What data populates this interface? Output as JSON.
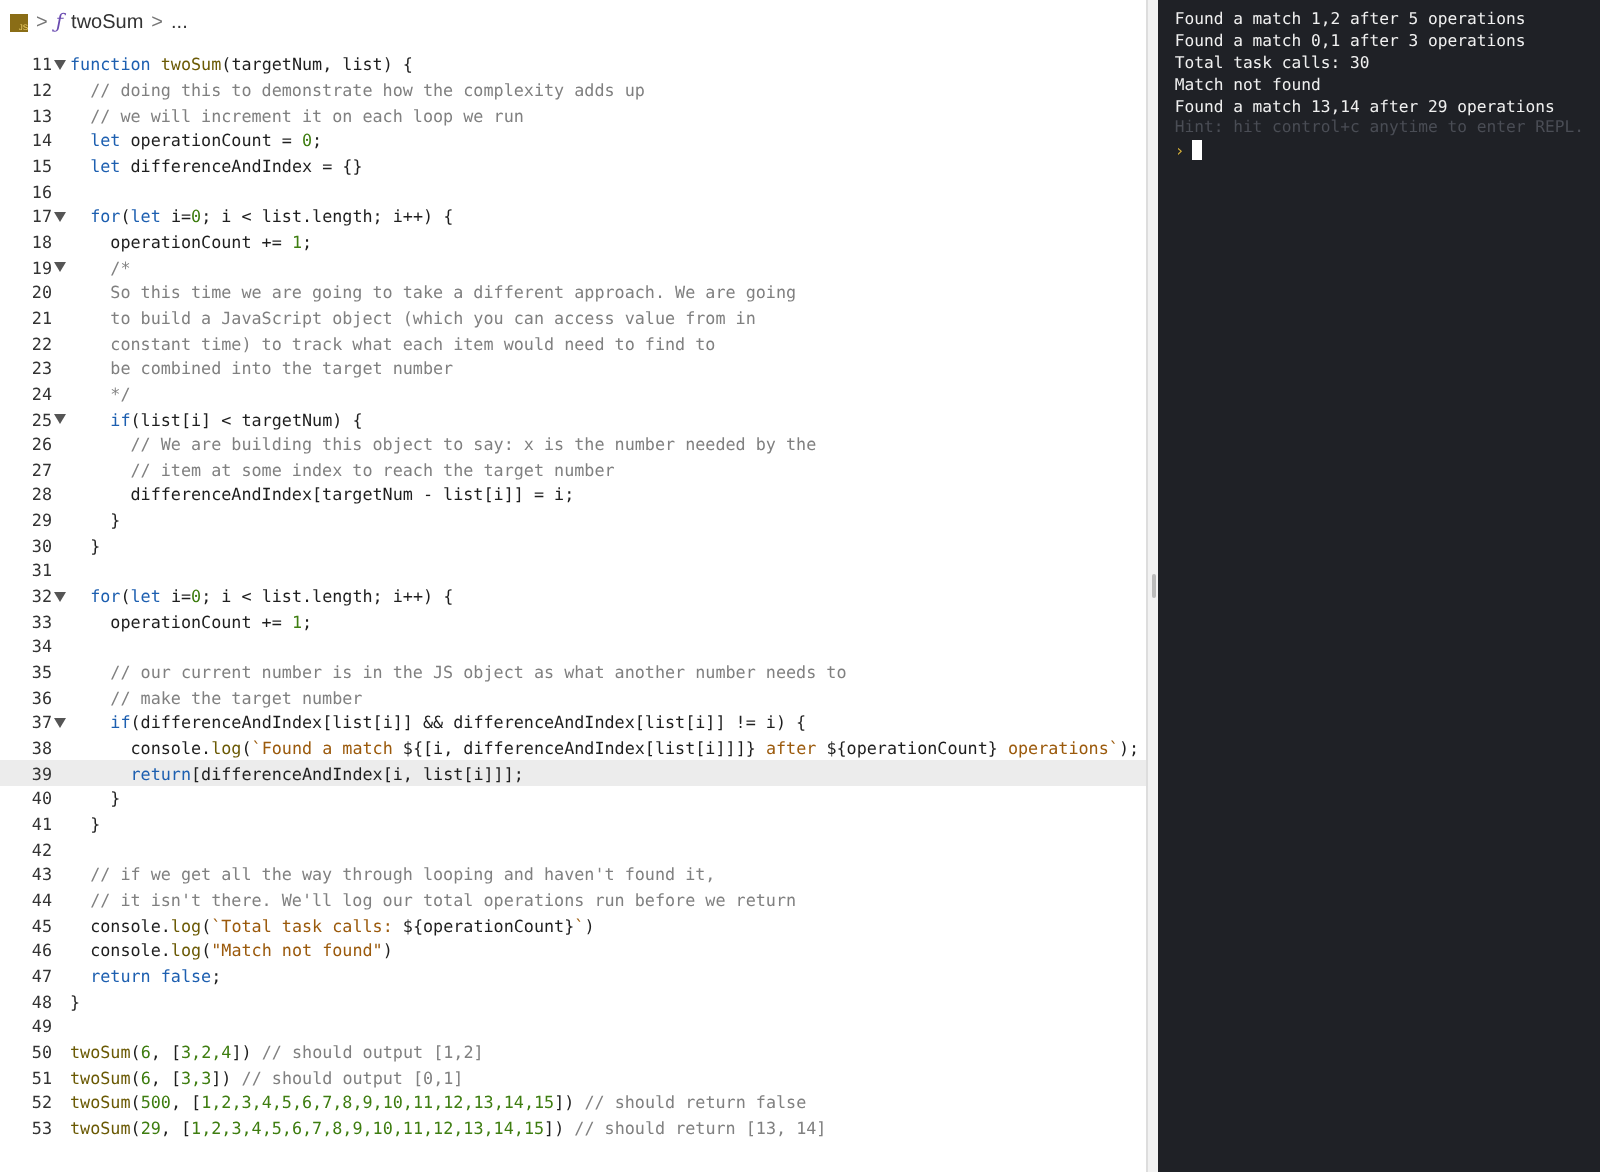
{
  "breadcrumb": {
    "file_icon": "JS",
    "symbol_icon": "ƒ",
    "symbol": "twoSum",
    "separator": ">",
    "rest": "..."
  },
  "editor": {
    "lines": [
      {
        "number": "11",
        "foldable": true,
        "current": false,
        "tokens": [
          {
            "kind": "kw",
            "text": "function "
          },
          {
            "kind": "fn",
            "text": "twoSum"
          },
          {
            "kind": "plain",
            "text": "(targetNum, list) {"
          }
        ]
      },
      {
        "number": "12",
        "foldable": false,
        "current": false,
        "tokens": [
          {
            "kind": "cm",
            "text": "  // doing this to demonstrate how the complexity adds up"
          }
        ]
      },
      {
        "number": "13",
        "foldable": false,
        "current": false,
        "tokens": [
          {
            "kind": "cm",
            "text": "  // we will increment it on each loop we run"
          }
        ]
      },
      {
        "number": "14",
        "foldable": false,
        "current": false,
        "tokens": [
          {
            "kind": "kw",
            "text": "  let "
          },
          {
            "kind": "plain",
            "text": "operationCount = "
          },
          {
            "kind": "num",
            "text": "0"
          },
          {
            "kind": "plain",
            "text": ";"
          }
        ]
      },
      {
        "number": "15",
        "foldable": false,
        "current": false,
        "tokens": [
          {
            "kind": "kw",
            "text": "  let "
          },
          {
            "kind": "plain",
            "text": "differenceAndIndex = {}"
          }
        ]
      },
      {
        "number": "16",
        "foldable": false,
        "current": false
      },
      {
        "number": "17",
        "foldable": true,
        "current": false,
        "tokens": [
          {
            "kind": "kw",
            "text": "  for"
          },
          {
            "kind": "plain",
            "text": "("
          },
          {
            "kind": "kw",
            "text": "let "
          },
          {
            "kind": "plain",
            "text": "i="
          },
          {
            "kind": "num",
            "text": "0"
          },
          {
            "kind": "plain",
            "text": "; i < list.length; i++) {"
          }
        ]
      },
      {
        "number": "18",
        "foldable": false,
        "current": false,
        "tokens": [
          {
            "kind": "plain",
            "text": "    operationCount += "
          },
          {
            "kind": "num",
            "text": "1"
          },
          {
            "kind": "plain",
            "text": ";"
          }
        ]
      },
      {
        "number": "19",
        "foldable": true,
        "current": false,
        "tokens": [
          {
            "kind": "cm",
            "text": "    /*"
          }
        ]
      },
      {
        "number": "20",
        "foldable": false,
        "current": false,
        "tokens": [
          {
            "kind": "cm",
            "text": "    So this time we are going to take a different approach. We are going"
          }
        ]
      },
      {
        "number": "21",
        "foldable": false,
        "current": false,
        "tokens": [
          {
            "kind": "cm",
            "text": "    to build a JavaScript object (which you can access value from in"
          }
        ]
      },
      {
        "number": "22",
        "foldable": false,
        "current": false,
        "tokens": [
          {
            "kind": "cm",
            "text": "    constant time) to track what each item would need to find to"
          }
        ]
      },
      {
        "number": "23",
        "foldable": false,
        "current": false,
        "tokens": [
          {
            "kind": "cm",
            "text": "    be combined into the target number"
          }
        ]
      },
      {
        "number": "24",
        "foldable": false,
        "current": false,
        "tokens": [
          {
            "kind": "cm",
            "text": "    */"
          }
        ]
      },
      {
        "number": "25",
        "foldable": true,
        "current": false,
        "tokens": [
          {
            "kind": "kw",
            "text": "    if"
          },
          {
            "kind": "plain",
            "text": "(list[i] < targetNum) {"
          }
        ]
      },
      {
        "number": "26",
        "foldable": false,
        "current": false,
        "tokens": [
          {
            "kind": "cm",
            "text": "      // We are building this object to say: x is the number needed by the"
          }
        ]
      },
      {
        "number": "27",
        "foldable": false,
        "current": false,
        "tokens": [
          {
            "kind": "cm",
            "text": "      // item at some index to reach the target number"
          }
        ]
      },
      {
        "number": "28",
        "foldable": false,
        "current": false,
        "tokens": [
          {
            "kind": "plain",
            "text": "      differenceAndIndex[targetNum - list[i]] = i;"
          }
        ]
      },
      {
        "number": "29",
        "foldable": false,
        "current": false,
        "tokens": [
          {
            "kind": "plain",
            "text": "    }"
          }
        ]
      },
      {
        "number": "30",
        "foldable": false,
        "current": false,
        "tokens": [
          {
            "kind": "plain",
            "text": "  }"
          }
        ]
      },
      {
        "number": "31",
        "foldable": false,
        "current": false
      },
      {
        "number": "32",
        "foldable": true,
        "current": false,
        "tokens": [
          {
            "kind": "kw",
            "text": "  for"
          },
          {
            "kind": "plain",
            "text": "("
          },
          {
            "kind": "kw",
            "text": "let "
          },
          {
            "kind": "plain",
            "text": "i="
          },
          {
            "kind": "num",
            "text": "0"
          },
          {
            "kind": "plain",
            "text": "; i < list.length; i++) {"
          }
        ]
      },
      {
        "number": "33",
        "foldable": false,
        "current": false,
        "tokens": [
          {
            "kind": "plain",
            "text": "    operationCount += "
          },
          {
            "kind": "num",
            "text": "1"
          },
          {
            "kind": "plain",
            "text": ";"
          }
        ]
      },
      {
        "number": "34",
        "foldable": false,
        "current": false
      },
      {
        "number": "35",
        "foldable": false,
        "current": false,
        "tokens": [
          {
            "kind": "cm",
            "text": "    // our current number is in the JS object as what another number needs to"
          }
        ]
      },
      {
        "number": "36",
        "foldable": false,
        "current": false,
        "tokens": [
          {
            "kind": "cm",
            "text": "    // make the target number"
          }
        ]
      },
      {
        "number": "37",
        "foldable": true,
        "current": false,
        "tokens": [
          {
            "kind": "kw",
            "text": "    if"
          },
          {
            "kind": "plain",
            "text": "(differenceAndIndex[list[i]] && differenceAndIndex[list[i]] != i) {"
          }
        ]
      },
      {
        "number": "38",
        "foldable": false,
        "current": false,
        "tokens": [
          {
            "kind": "plain",
            "text": "      console."
          },
          {
            "kind": "fn",
            "text": "log"
          },
          {
            "kind": "plain",
            "text": "("
          },
          {
            "kind": "str",
            "text": "`Found a match "
          },
          {
            "kind": "plain",
            "text": "${[i, differenceAndIndex[list[i]]]}"
          },
          {
            "kind": "str",
            "text": " after "
          },
          {
            "kind": "plain",
            "text": "${operationCount}"
          },
          {
            "kind": "str",
            "text": " operations`"
          },
          {
            "kind": "plain",
            "text": ");"
          }
        ]
      },
      {
        "number": "39",
        "foldable": false,
        "current": true,
        "tokens": [
          {
            "kind": "kw",
            "text": "      return"
          },
          {
            "kind": "plain",
            "text": "[differenceAndIndex[i, list[i]]];"
          }
        ]
      },
      {
        "number": "40",
        "foldable": false,
        "current": false,
        "tokens": [
          {
            "kind": "plain",
            "text": "    }"
          }
        ]
      },
      {
        "number": "41",
        "foldable": false,
        "current": false,
        "tokens": [
          {
            "kind": "plain",
            "text": "  }"
          }
        ]
      },
      {
        "number": "42",
        "foldable": false,
        "current": false
      },
      {
        "number": "43",
        "foldable": false,
        "current": false,
        "tokens": [
          {
            "kind": "cm",
            "text": "  // if we get all the way through looping and haven't found it,"
          }
        ]
      },
      {
        "number": "44",
        "foldable": false,
        "current": false,
        "tokens": [
          {
            "kind": "cm",
            "text": "  // it isn't there. We'll log our total operations run before we return"
          }
        ]
      },
      {
        "number": "45",
        "foldable": false,
        "current": false,
        "tokens": [
          {
            "kind": "plain",
            "text": "  console."
          },
          {
            "kind": "fn",
            "text": "log"
          },
          {
            "kind": "plain",
            "text": "("
          },
          {
            "kind": "str",
            "text": "`Total task calls: "
          },
          {
            "kind": "plain",
            "text": "${operationCount}"
          },
          {
            "kind": "str",
            "text": "`"
          },
          {
            "kind": "plain",
            "text": ")"
          }
        ]
      },
      {
        "number": "46",
        "foldable": false,
        "current": false,
        "tokens": [
          {
            "kind": "plain",
            "text": "  console."
          },
          {
            "kind": "fn",
            "text": "log"
          },
          {
            "kind": "plain",
            "text": "("
          },
          {
            "kind": "str",
            "text": "\"Match not found\""
          },
          {
            "kind": "plain",
            "text": ")"
          }
        ]
      },
      {
        "number": "47",
        "foldable": false,
        "current": false,
        "tokens": [
          {
            "kind": "kw",
            "text": "  return false"
          },
          {
            "kind": "plain",
            "text": ";"
          }
        ]
      },
      {
        "number": "48",
        "foldable": false,
        "current": false,
        "tokens": [
          {
            "kind": "plain",
            "text": "}"
          }
        ]
      },
      {
        "number": "49",
        "foldable": false,
        "current": false
      },
      {
        "number": "50",
        "foldable": false,
        "current": false,
        "tokens": [
          {
            "kind": "fn",
            "text": "twoSum"
          },
          {
            "kind": "plain",
            "text": "("
          },
          {
            "kind": "num",
            "text": "6"
          },
          {
            "kind": "plain",
            "text": ", ["
          },
          {
            "kind": "num",
            "text": "3,2,4"
          },
          {
            "kind": "plain",
            "text": "]) "
          },
          {
            "kind": "cm",
            "text": "// should output [1,2]"
          }
        ]
      },
      {
        "number": "51",
        "foldable": false,
        "current": false,
        "tokens": [
          {
            "kind": "fn",
            "text": "twoSum"
          },
          {
            "kind": "plain",
            "text": "("
          },
          {
            "kind": "num",
            "text": "6"
          },
          {
            "kind": "plain",
            "text": ", ["
          },
          {
            "kind": "num",
            "text": "3,3"
          },
          {
            "kind": "plain",
            "text": "]) "
          },
          {
            "kind": "cm",
            "text": "// should output [0,1]"
          }
        ]
      },
      {
        "number": "52",
        "foldable": false,
        "current": false,
        "tokens": [
          {
            "kind": "fn",
            "text": "twoSum"
          },
          {
            "kind": "plain",
            "text": "("
          },
          {
            "kind": "num",
            "text": "500"
          },
          {
            "kind": "plain",
            "text": ", ["
          },
          {
            "kind": "num",
            "text": "1,2,3,4,5,6,7,8,9,10,11,12,13,14,15"
          },
          {
            "kind": "plain",
            "text": "]) "
          },
          {
            "kind": "cm",
            "text": "// should return false"
          }
        ]
      },
      {
        "number": "53",
        "foldable": false,
        "current": false,
        "tokens": [
          {
            "kind": "fn",
            "text": "twoSum"
          },
          {
            "kind": "plain",
            "text": "("
          },
          {
            "kind": "num",
            "text": "29"
          },
          {
            "kind": "plain",
            "text": ", ["
          },
          {
            "kind": "num",
            "text": "1,2,3,4,5,6,7,8,9,10,11,12,13,14,15"
          },
          {
            "kind": "plain",
            "text": "]) "
          },
          {
            "kind": "cm",
            "text": "// should return [13, 14]"
          }
        ]
      }
    ]
  },
  "console": {
    "lines": [
      {
        "kind": "output",
        "text": "Found a match 1,2 after 5 operations"
      },
      {
        "kind": "output",
        "text": "Found a match 0,1 after 3 operations"
      },
      {
        "kind": "output",
        "text": "Total task calls: 30"
      },
      {
        "kind": "output",
        "text": "Match not found"
      },
      {
        "kind": "output",
        "text": "Found a match 13,14 after 29 operations"
      },
      {
        "kind": "hint",
        "text": "Hint: hit control+c anytime to enter REPL."
      },
      {
        "kind": "prompt",
        "text": "›"
      }
    ]
  }
}
